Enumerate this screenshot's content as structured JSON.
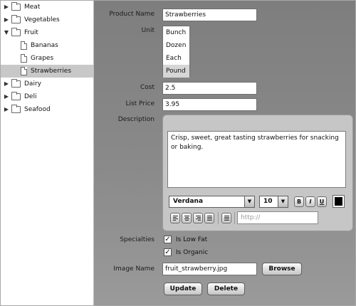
{
  "tree": {
    "items": [
      {
        "label": "Meat",
        "type": "folder",
        "expanded": false
      },
      {
        "label": "Vegetables",
        "type": "folder",
        "expanded": false
      },
      {
        "label": "Fruit",
        "type": "folder",
        "expanded": true
      },
      {
        "label": "Bananas",
        "type": "document"
      },
      {
        "label": "Grapes",
        "type": "document"
      },
      {
        "label": "Strawberries",
        "type": "document",
        "selected": true
      },
      {
        "label": "Dairy",
        "type": "folder",
        "expanded": false
      },
      {
        "label": "Deli",
        "type": "folder",
        "expanded": false
      },
      {
        "label": "Seafood",
        "type": "folder",
        "expanded": false
      }
    ]
  },
  "form": {
    "product_name_label": "Product Name",
    "product_name_value": "Strawberries",
    "unit_label": "Unit",
    "unit_options": [
      "Bunch",
      "Dozen",
      "Each",
      "Pound"
    ],
    "unit_selected": "Pound",
    "cost_label": "Cost",
    "cost_value": "2.5",
    "list_price_label": "List Price",
    "list_price_value": "3.95",
    "description_label": "Description",
    "description_text": "Crisp, sweet, great tasting strawberries for snacking or baking.",
    "editor": {
      "font_family": "Verdana",
      "font_size": "10",
      "bold": "B",
      "italic": "I",
      "underline": "U",
      "text_color": "#000000",
      "link_placeholder": "http://"
    },
    "specialties_label": "Specialties",
    "low_fat_label": "Is Low Fat",
    "low_fat_checked": true,
    "organic_label": "Is Organic",
    "organic_checked": true,
    "check_mark": "✓",
    "image_name_label": "Image Name",
    "image_name_value": "fruit_strawberry.jpg",
    "browse_label": "Browse",
    "update_label": "Update",
    "delete_label": "Delete"
  },
  "icons": {
    "collapsed": "▶",
    "expanded": "▼",
    "dropdown": "▼"
  },
  "colors": {
    "panel_background": "#8a8a8a",
    "tree_selection": "#c8c8c8",
    "editor_background": "#c6c6c6"
  }
}
